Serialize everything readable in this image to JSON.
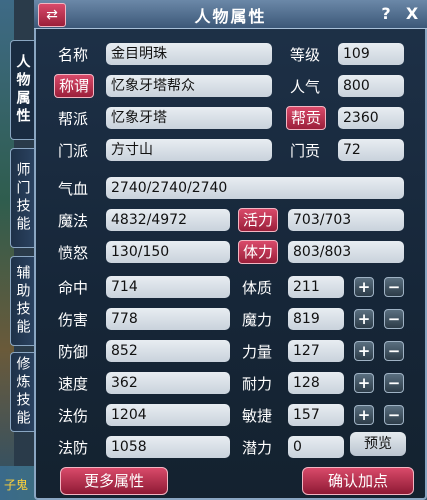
{
  "window": {
    "title": "人物属性",
    "help": "?",
    "close": "X",
    "swap_icon": "⇄"
  },
  "tabs": [
    "人物属性",
    "师门技能",
    "辅助技能",
    "修炼技能"
  ],
  "background": {
    "bottom_text": "子鬼"
  },
  "info": {
    "name_label": "名称",
    "name_value": "金目明珠",
    "level_label": "等级",
    "level_value": "109",
    "title_label": "称谓",
    "title_value": "忆象牙塔帮众",
    "popularity_label": "人气",
    "popularity_value": "800",
    "gang_label": "帮派",
    "gang_value": "忆象牙塔",
    "gang_contrib_label": "帮贡",
    "gang_contrib_value": "2360",
    "school_label": "门派",
    "school_value": "方寸山",
    "school_contrib_label": "门贡",
    "school_contrib_value": "72"
  },
  "vitals": {
    "hp_label": "气血",
    "hp_value": "2740/2740/2740",
    "mp_label": "魔法",
    "mp_value": "4832/4972",
    "vigor_label": "活力",
    "vigor_value": "703/703",
    "anger_label": "愤怒",
    "anger_value": "130/150",
    "stamina_label": "体力",
    "stamina_value": "803/803"
  },
  "combat_stats": [
    {
      "label": "命中",
      "value": "714"
    },
    {
      "label": "伤害",
      "value": "778"
    },
    {
      "label": "防御",
      "value": "852"
    },
    {
      "label": "速度",
      "value": "362"
    },
    {
      "label": "法伤",
      "value": "1204"
    },
    {
      "label": "法防",
      "value": "1058"
    }
  ],
  "attributes": [
    {
      "label": "体质",
      "value": "211"
    },
    {
      "label": "魔力",
      "value": "819"
    },
    {
      "label": "力量",
      "value": "127"
    },
    {
      "label": "耐力",
      "value": "128"
    },
    {
      "label": "敏捷",
      "value": "157"
    },
    {
      "label": "潜力",
      "value": "0"
    }
  ],
  "buttons": {
    "plus": "+",
    "minus": "−",
    "preview": "预览",
    "more_attributes": "更多属性",
    "confirm_points": "确认加点"
  },
  "colors": {
    "accent": "#c0304f",
    "panel": "#1e3148",
    "frame_border": "#8aa6c2"
  }
}
